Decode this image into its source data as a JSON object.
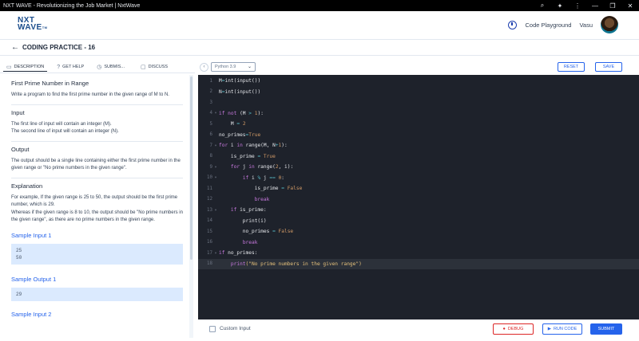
{
  "titlebar": {
    "title": "NXT WAVE - Revolutionizing the Job Market | NxtWave",
    "icons": [
      "search-icon",
      "puzzle-icon",
      "menu-icon",
      "minimize-icon",
      "restore-icon",
      "close-icon"
    ]
  },
  "header": {
    "logo_line1": "NXT",
    "logo_line2": "WAVE",
    "logo_tm": "TM",
    "playground_label": "Code Playground",
    "user_name": "Vasu"
  },
  "subheader": {
    "title": "CODING PRACTICE - 16"
  },
  "tabs": [
    {
      "label": "DESCRIPTION",
      "icon": "document-icon"
    },
    {
      "label": "GET HELP",
      "icon": "help-icon"
    },
    {
      "label": "SUBMIS...",
      "icon": "clock-icon"
    },
    {
      "label": "DISCUSS",
      "icon": "chat-icon"
    }
  ],
  "problem": {
    "title": "First Prime Number in Range",
    "statement": "Write a program to find the first prime number in the given range of M to N.",
    "input_heading": "Input",
    "input_line1": "The first line of input will contain an integer (M).",
    "input_line2": "The second line of input will contain an integer (N).",
    "output_heading": "Output",
    "output_text": "The output should be a single line containing either the first prime number in the given range or \"No prime numbers in the given range\".",
    "explanation_heading": "Explanation",
    "explanation_p1": "For example, If the given range is 25 to 50, the output should be the first prime number, which is 29.",
    "explanation_p2": "Whereas if the given range is 8 to 10, the output should be \"No prime numbers in the given range\", as there are no prime numbers in the given range.",
    "sample_input1_label": "Sample Input 1",
    "sample_input1_line1": "25",
    "sample_input1_line2": "50",
    "sample_output1_label": "Sample Output 1",
    "sample_output1": "29",
    "sample_input2_label": "Sample Input 2"
  },
  "editor": {
    "language": "Python 3.9",
    "reset_label": "RESET",
    "save_label": "SAVE",
    "lines": [
      {
        "n": "1",
        "fold": "",
        "code": "<span class='fn'>M</span><span class='op'>=</span>int(input())"
      },
      {
        "n": "2",
        "fold": "",
        "code": "N<span class='op'>=</span>int(input())"
      },
      {
        "n": "3",
        "fold": "",
        "code": ""
      },
      {
        "n": "4",
        "fold": "▾",
        "code": "<span class='kw'>if not</span> (M <span class='op'>&gt;</span> <span class='num'>1</span>):"
      },
      {
        "n": "5",
        "fold": "",
        "code": "    M <span class='op'>=</span> <span class='num'>2</span>"
      },
      {
        "n": "6",
        "fold": "",
        "code": "no_primes<span class='op'>=</span><span class='num'>True</span>"
      },
      {
        "n": "7",
        "fold": "▾",
        "code": "<span class='kw'>for</span> i <span class='kw'>in</span> range(M, N<span class='op'>+</span><span class='num'>1</span>):"
      },
      {
        "n": "8",
        "fold": "",
        "code": "    is_prime <span class='op'>=</span> <span class='num'>True</span>"
      },
      {
        "n": "9",
        "fold": "▾",
        "code": "    <span class='kw'>for</span> j <span class='kw'>in</span> range(<span class='num'>2</span>, i):"
      },
      {
        "n": "10",
        "fold": "▾",
        "code": "        <span class='kw'>if</span> i <span class='op'>%</span> j <span class='op'>==</span> <span class='num'>0</span>:"
      },
      {
        "n": "11",
        "fold": "",
        "code": "            is_prime <span class='op'>=</span> <span class='num'>False</span>"
      },
      {
        "n": "12",
        "fold": "",
        "code": "            <span class='kw'>break</span>"
      },
      {
        "n": "13",
        "fold": "▾",
        "code": "    <span class='kw'>if</span> is_prime:"
      },
      {
        "n": "14",
        "fold": "",
        "code": "        print(i)"
      },
      {
        "n": "15",
        "fold": "",
        "code": "        no_primes <span class='op'>=</span> <span class='num'>False</span>"
      },
      {
        "n": "16",
        "fold": "",
        "code": "        <span class='kw'>break</span>"
      },
      {
        "n": "17",
        "fold": "▾",
        "code": "<span class='kw'>if</span> no_primes:"
      },
      {
        "n": "18",
        "fold": "",
        "code": "    <span class='kw'>print</span><span class='str'>(\"No prime numbers in the given range\")</span>"
      }
    ]
  },
  "footer": {
    "custom_input_label": "Custom Input",
    "debug_label": "DEBUG",
    "run_label": "RUN CODE",
    "submit_label": "SUBMIT"
  }
}
